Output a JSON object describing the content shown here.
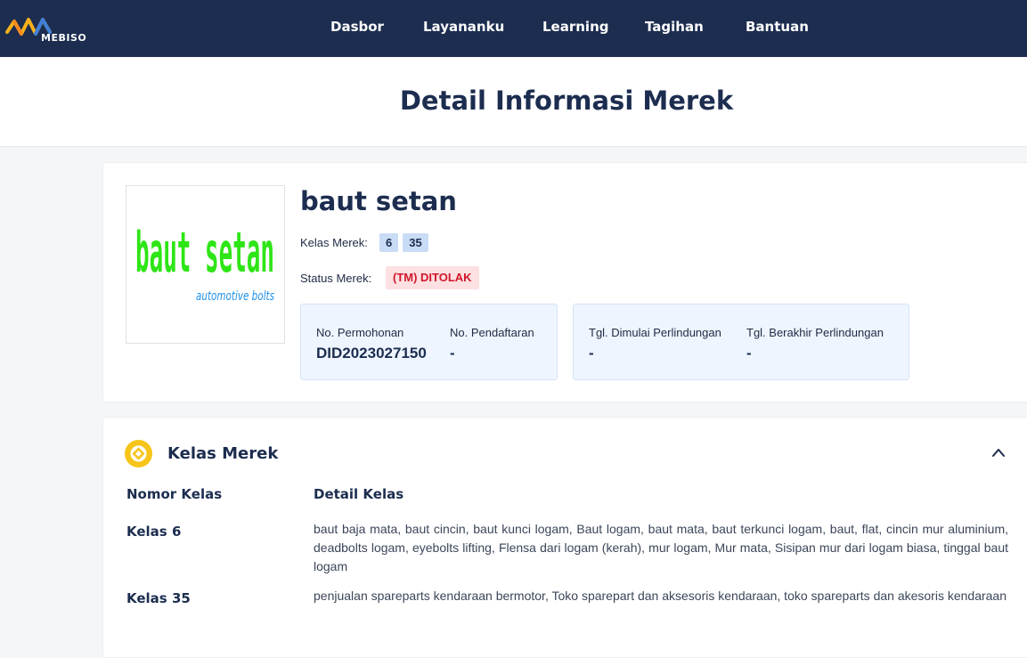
{
  "header": {
    "logo_text": "MEBISO",
    "nav": [
      {
        "label": "Dasbor"
      },
      {
        "label": "Layananku"
      },
      {
        "label": "Learning"
      },
      {
        "label": "Tagihan"
      },
      {
        "label": "Bantuan"
      }
    ]
  },
  "page": {
    "title": "Detail Informasi Merek"
  },
  "brand": {
    "name": "baut setan",
    "image_text_main": "baut setan",
    "image_text_sub": "automotive bolts",
    "kelas_label": "Kelas Merek:",
    "kelas": [
      "6",
      "35"
    ],
    "status_label": "Status Merek:",
    "status": "(TM) DITOLAK",
    "no_permohonan_label": "No. Permohonan",
    "no_permohonan": "DID2023027150",
    "no_pendaftaran_label": "No. Pendaftaran",
    "no_pendaftaran": "-",
    "tgl_mulai_label": "Tgl. Dimulai Perlindungan",
    "tgl_mulai": "-",
    "tgl_akhir_label": "Tgl. Berakhir Perlindungan",
    "tgl_akhir": "-"
  },
  "kelas_section": {
    "title": "Kelas Merek",
    "col_nomor": "Nomor Kelas",
    "col_detail": "Detail Kelas",
    "rows": [
      {
        "nomor": "Kelas 6",
        "detail": "baut baja mata, baut cincin, baut kunci logam, Baut logam, baut mata, baut terkunci logam, baut, flat, cincin mur aluminium, deadbolts logam, eyebolts lifting, Flensa dari logam (kerah), mur logam, Mur mata, Sisipan mur dari logam biasa, tinggal baut logam"
      },
      {
        "nomor": "Kelas 35",
        "detail": "penjualan spareparts kendaraan bermotor, Toko sparepart dan aksesoris kendaraan, toko spareparts dan akesoris kendaraan"
      }
    ]
  },
  "colors": {
    "nav_bg": "#1c2d4f",
    "title": "#1c2d4f",
    "status_bg": "#fde0e2",
    "status_text": "#d0182b",
    "badge_bg": "#c9dcf5",
    "info_box_bg": "#eef5ff",
    "logo_green": "#2ee516",
    "logo_cyan": "#18e3d6",
    "logo_blue": "#1e90e8",
    "icon_yellow": "#f7c51a"
  }
}
